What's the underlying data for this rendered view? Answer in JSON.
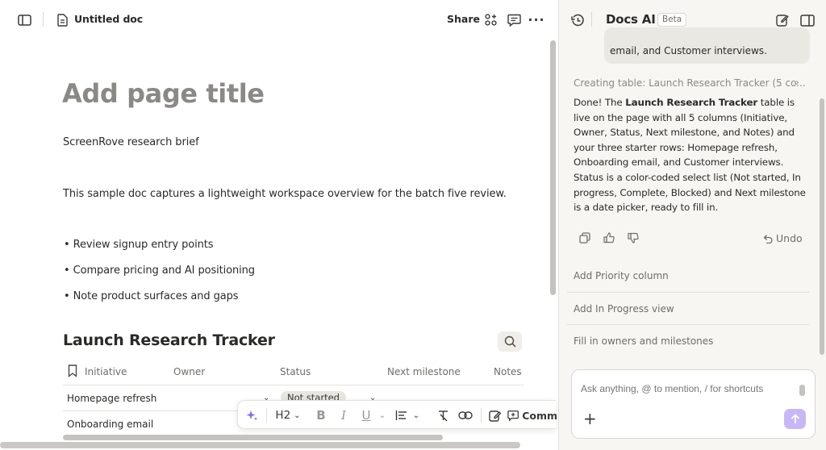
{
  "document": {
    "name": "Untitled doc",
    "share_label": "Share",
    "page_title_placeholder": "Add page title",
    "subtitle": "ScreenRove research brief",
    "intro": "This sample doc captures a lightweight workspace overview for the batch five review.",
    "bullets": [
      "Review signup entry points",
      "Compare pricing and AI positioning",
      "Note product surfaces and gaps"
    ],
    "table": {
      "title": "Launch Research Tracker",
      "columns": [
        "Initiative",
        "Owner",
        "Status",
        "Next milestone",
        "Notes"
      ],
      "rows": [
        {
          "initiative": "Homepage refresh",
          "owner": "",
          "status": "Not started",
          "next_milestone": "",
          "notes": ""
        },
        {
          "initiative": "Onboarding email",
          "owner": "",
          "status": "",
          "next_milestone": "",
          "notes": ""
        }
      ]
    }
  },
  "format_toolbar": {
    "heading_level": "H2",
    "comment_label": "Comm"
  },
  "ai_panel": {
    "title": "Docs AI",
    "badge": "Beta",
    "user_message_tail": "email, and Customer interviews.",
    "status_line": "Creating table: Launch Research Tracker (5 co...",
    "answer": {
      "prefix": "Done! The ",
      "bold": "Launch Research Tracker",
      "rest": " table is live on the page with all 5 columns (Initiative, Owner, Status, Next milestone, and Notes) and your three starter rows: Homepage refresh, Onboarding email, and Customer interviews. Status is a color-coded select list (Not started, In progress, Complete, Blocked) and Next milestone is a date picker, ready to fill in."
    },
    "undo_label": "Undo",
    "suggestions": [
      "Add Priority column",
      "Add In Progress view",
      "Fill in owners and milestones"
    ],
    "composer_placeholder": "Ask anything, @ to mention, / for shortcuts"
  },
  "colors": {
    "accent_send": "#c8b7f5",
    "ai_sparkle": "#8a6ce0",
    "panel_bg": "#f7f6f3"
  }
}
